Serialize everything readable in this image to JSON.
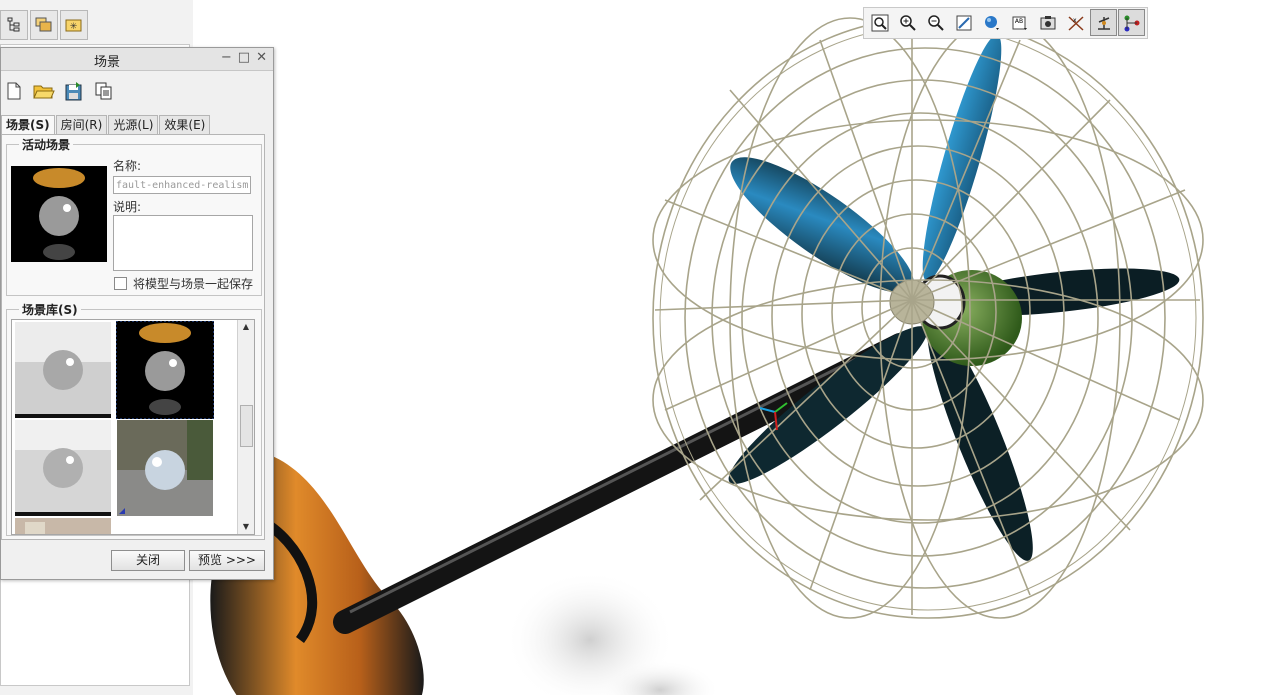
{
  "left_panel": {
    "tabs": [
      {
        "icon": "model-tree-icon"
      },
      {
        "icon": "layers-icon"
      },
      {
        "icon": "favorites-folder-icon"
      }
    ]
  },
  "graphics_toolbar": {
    "buttons": [
      {
        "icon": "refit-icon"
      },
      {
        "icon": "zoom-in-icon"
      },
      {
        "icon": "zoom-out-icon"
      },
      {
        "icon": "repaint-icon"
      },
      {
        "icon": "display-style-icon"
      },
      {
        "icon": "saved-views-icon"
      },
      {
        "icon": "view-manager-icon"
      },
      {
        "icon": "datum-display-icon"
      },
      {
        "icon": "spin-center-icon",
        "active": true
      },
      {
        "icon": "annotation-display-icon",
        "active": true
      }
    ]
  },
  "dialog": {
    "title": "场景",
    "window_buttons": {
      "minimize": "−",
      "maximize": "□",
      "close": "✕"
    },
    "toolbar": [
      {
        "icon": "new-file-icon"
      },
      {
        "icon": "open-folder-icon"
      },
      {
        "icon": "save-icon"
      },
      {
        "icon": "copy-icon"
      }
    ],
    "tabs": [
      {
        "label": "场景(S)",
        "active": true
      },
      {
        "label": "房间(R)"
      },
      {
        "label": "光源(L)"
      },
      {
        "label": "效果(E)"
      }
    ],
    "active_scene": {
      "legend": "活动场景",
      "name_label": "名称:",
      "name_value": "fault-enhanced-realism",
      "desc_label": "说明:",
      "desc_value": "",
      "save_with_model_label": "将模型与场景一起保存",
      "save_with_model_checked": false
    },
    "library": {
      "legend": "场景库(S)"
    },
    "close_button": "关闭",
    "preview_button": "预览 >>>"
  },
  "colors": {
    "dialog_bg": "#f0f0f0",
    "fan_blade_blue": "#2a8ac0",
    "fan_blade_dark": "#0b1e24",
    "cage_wire": "#a8a48a",
    "motor_green": "#4a7a2a",
    "base_orange": "#d2781e"
  }
}
